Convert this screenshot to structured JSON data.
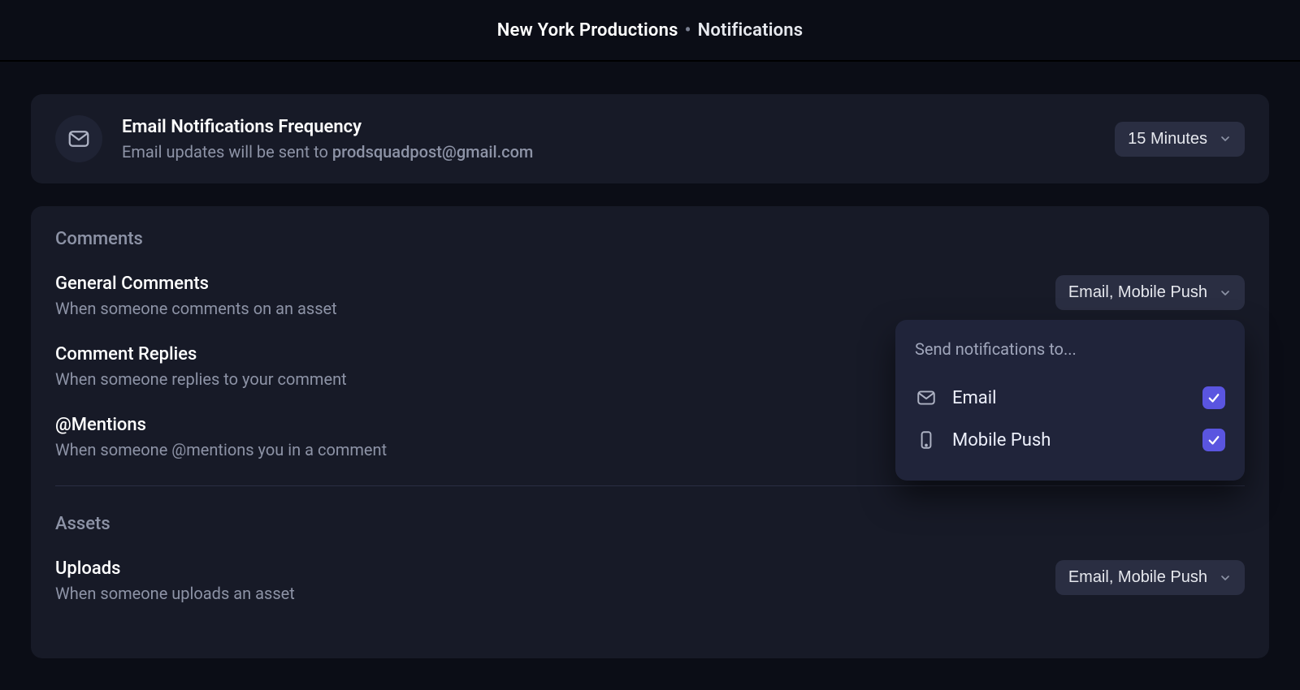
{
  "header": {
    "workspace": "New York Productions",
    "separator": "•",
    "section": "Notifications"
  },
  "frequency": {
    "icon": "mail-icon",
    "title": "Email Notifications Frequency",
    "sub_prefix": "Email updates will be sent to ",
    "email": "prodsquadpost@gmail.com",
    "value": "15 Minutes"
  },
  "sections": {
    "comments": {
      "heading": "Comments",
      "rows": {
        "general": {
          "title": "General Comments",
          "sub": "When someone comments on an asset",
          "value": "Email, Mobile Push"
        },
        "replies": {
          "title": "Comment Replies",
          "sub": "When someone replies to your comment"
        },
        "mentions": {
          "title": "@Mentions",
          "sub": "When someone @mentions you in a comment"
        }
      }
    },
    "assets": {
      "heading": "Assets",
      "rows": {
        "uploads": {
          "title": "Uploads",
          "sub": "When someone uploads an asset",
          "value": "Email, Mobile Push"
        }
      }
    }
  },
  "popover": {
    "title": "Send notifications to...",
    "options": {
      "email": {
        "label": "Email",
        "checked": true
      },
      "mobile": {
        "label": "Mobile Push",
        "checked": true
      }
    }
  },
  "colors": {
    "accent": "#5a55e0",
    "bg": "#0b0d16",
    "card": "#171a27",
    "pop": "#20243a"
  }
}
